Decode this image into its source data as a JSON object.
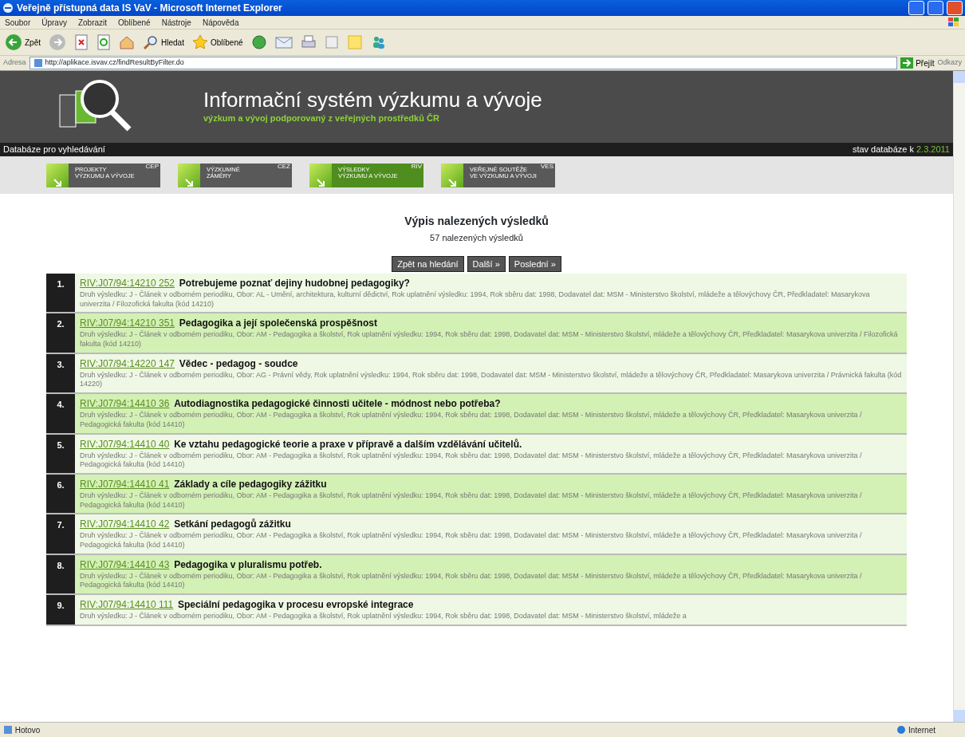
{
  "window": {
    "title": "Veřejně přístupná data IS VaV - Microsoft Internet Explorer"
  },
  "menu": [
    "Soubor",
    "Úpravy",
    "Zobrazit",
    "Oblíbené",
    "Nástroje",
    "Nápověda"
  ],
  "toolbar": {
    "back": "Zpět",
    "search": "Hledat",
    "favorites": "Oblíbené"
  },
  "address": {
    "label": "Adresa",
    "value": "http://aplikace.isvav.cz/findResultByFilter.do",
    "go": "Přejít",
    "links": "Odkazy"
  },
  "site": {
    "title": "Informační systém výzkumu a vývoje",
    "subtitle": "výzkum a vývoj podporovaný z veřejných prostředků ČR"
  },
  "db_bar": {
    "label": "Databáze pro vyhledávání",
    "state_label": "stav databáze k",
    "state_date": "2.3.2011"
  },
  "db_tabs": [
    {
      "line1": "PROJEKTY",
      "line2": "VÝZKUMU A VÝVOJE",
      "code": "CEP",
      "selected": false
    },
    {
      "line1": "VÝZKUMNÉ",
      "line2": "ZÁMĚRY",
      "code": "CEZ",
      "selected": false
    },
    {
      "line1": "VÝSLEDKY",
      "line2": "VÝZKUMU A VÝVOJE",
      "code": "RIV",
      "selected": true
    },
    {
      "line1": "VEŘEJNÉ SOUTĚŽE",
      "line2": "VE VÝZKUMU A VÝVOJI",
      "code": "VES",
      "selected": false
    }
  ],
  "results_heading": "Výpis nalezených výsledků",
  "results_count": "57 nalezených výsledků",
  "pager": [
    "Zpět na hledání",
    "Další »",
    "Poslední »"
  ],
  "results": [
    {
      "number": "1.",
      "code": "RIV:J07/94:14210 252",
      "title": "Potrebujeme poznať dejiny hudobnej pedagogiky?",
      "description": "Druh výsledku: J - Článek v odborném periodiku, Obor: AL - Umění, architektura, kulturní dědictví, Rok uplatnění výsledku: 1994, Rok sběru dat: 1998, Dodavatel dat: MSM - Ministerstvo školství, mládeže a tělovýchovy ČR, Předkladatel: Masarykova univerzita / Filozofická fakulta (kód 14210)"
    },
    {
      "number": "2.",
      "code": "RIV:J07/94:14210 351",
      "title": "Pedagogika a její společenská prospěšnost",
      "description": "Druh výsledku: J - Článek v odborném periodiku, Obor: AM - Pedagogika a školství, Rok uplatnění výsledku: 1994, Rok sběru dat: 1998, Dodavatel dat: MSM - Ministerstvo školství, mládeže a tělovýchovy ČR, Předkladatel: Masarykova univerzita / Filozofická fakulta (kód 14210)"
    },
    {
      "number": "3.",
      "code": "RIV:J07/94:14220 147",
      "title": "Vědec - pedagog - soudce",
      "description": "Druh výsledku: J - Článek v odborném periodiku, Obor: AG - Právní vědy, Rok uplatnění výsledku: 1994, Rok sběru dat: 1998, Dodavatel dat: MSM - Ministerstvo školství, mládeže a tělovýchovy ČR, Předkladatel: Masarykova univerzita / Právnická fakulta (kód 14220)"
    },
    {
      "number": "4.",
      "code": "RIV:J07/94:14410 36",
      "title": "Autodiagnostika pedagogické činnosti učitele - módnost nebo potřeba?",
      "description": "Druh výsledku: J - Článek v odborném periodiku, Obor: AM - Pedagogika a školství, Rok uplatnění výsledku: 1994, Rok sběru dat: 1998, Dodavatel dat: MSM - Ministerstvo školství, mládeže a tělovýchovy ČR, Předkladatel: Masarykova univerzita / Pedagogická fakulta (kód 14410)"
    },
    {
      "number": "5.",
      "code": "RIV:J07/94:14410 40",
      "title": "Ke vztahu pedagogické teorie a praxe v přípravě a dalším vzdělávání učitelů.",
      "description": "Druh výsledku: J - Článek v odborném periodiku, Obor: AM - Pedagogika a školství, Rok uplatnění výsledku: 1994, Rok sběru dat: 1998, Dodavatel dat: MSM - Ministerstvo školství, mládeže a tělovýchovy ČR, Předkladatel: Masarykova univerzita / Pedagogická fakulta (kód 14410)"
    },
    {
      "number": "6.",
      "code": "RIV:J07/94:14410 41",
      "title": "Základy a cíle pedagogiky zážitku",
      "description": "Druh výsledku: J - Článek v odborném periodiku, Obor: AM - Pedagogika a školství, Rok uplatnění výsledku: 1994, Rok sběru dat: 1998, Dodavatel dat: MSM - Ministerstvo školství, mládeže a tělovýchovy ČR, Předkladatel: Masarykova univerzita / Pedagogická fakulta (kód 14410)"
    },
    {
      "number": "7.",
      "code": "RIV:J07/94:14410 42",
      "title": "Setkání pedagogů zážitku",
      "description": "Druh výsledku: J - Článek v odborném periodiku, Obor: AM - Pedagogika a školství, Rok uplatnění výsledku: 1994, Rok sběru dat: 1998, Dodavatel dat: MSM - Ministerstvo školství, mládeže a tělovýchovy ČR, Předkladatel: Masarykova univerzita / Pedagogická fakulta (kód 14410)"
    },
    {
      "number": "8.",
      "code": "RIV:J07/94:14410 43",
      "title": "Pedagogika v pluralismu potřeb.",
      "description": "Druh výsledku: J - Článek v odborném periodiku, Obor: AM - Pedagogika a školství, Rok uplatnění výsledku: 1994, Rok sběru dat: 1998, Dodavatel dat: MSM - Ministerstvo školství, mládeže a tělovýchovy ČR, Předkladatel: Masarykova univerzita / Pedagogická fakulta (kód 14410)"
    },
    {
      "number": "9.",
      "code": "RIV:J07/94:14410 111",
      "title": "Speciální pedagogika v procesu evropské integrace",
      "description": "Druh výsledku: J - Článek v odborném periodiku, Obor: AM - Pedagogika a školství, Rok uplatnění výsledku: 1994, Rok sběru dat: 1998, Dodavatel dat: MSM - Ministerstvo školství, mládeže a"
    }
  ],
  "status_bar": {
    "text": "Hotovo",
    "zone": "Internet"
  }
}
